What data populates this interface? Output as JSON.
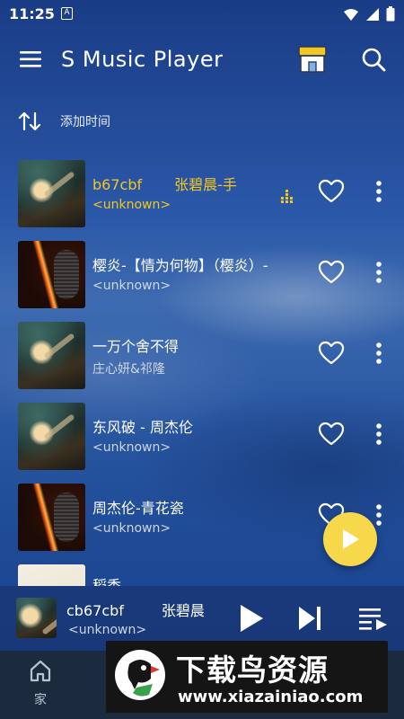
{
  "status_bar": {
    "time": "11:25",
    "notification_badge": "A"
  },
  "app_bar": {
    "title": "S Music Player",
    "menu_icon": "menu-icon",
    "store_icon": "store-icon",
    "search_icon": "search-icon"
  },
  "sort": {
    "label": "添加时间",
    "icon": "sort-arrows-icon"
  },
  "songs": [
    {
      "title": "b67cbf",
      "title_extra": "张碧晨-手",
      "artist": "<unknown>",
      "playing": true
    },
    {
      "title": "樱炎-【情为何物】（樱炎）-",
      "artist": "<unknown>"
    },
    {
      "title": "一万个舍不得",
      "artist": "庄心妍&祁隆"
    },
    {
      "title": "东风破  - 周杰伦",
      "artist": "<unknown>"
    },
    {
      "title": "周杰伦-青花瓷",
      "artist": "<unknown>"
    },
    {
      "title": "稻香",
      "artist": ""
    }
  ],
  "mini_player": {
    "title": "cb67cbf",
    "title_extra": "张碧晨",
    "artist": "<unknown>"
  },
  "bottom_nav": {
    "home_label": "家"
  },
  "watermark": {
    "title": "下载鸟资源",
    "url": "www.xiazainiao.com"
  },
  "colors": {
    "accent": "#f3c623",
    "fab": "#f6d84a",
    "nav_bg": "#1c2a3d"
  }
}
